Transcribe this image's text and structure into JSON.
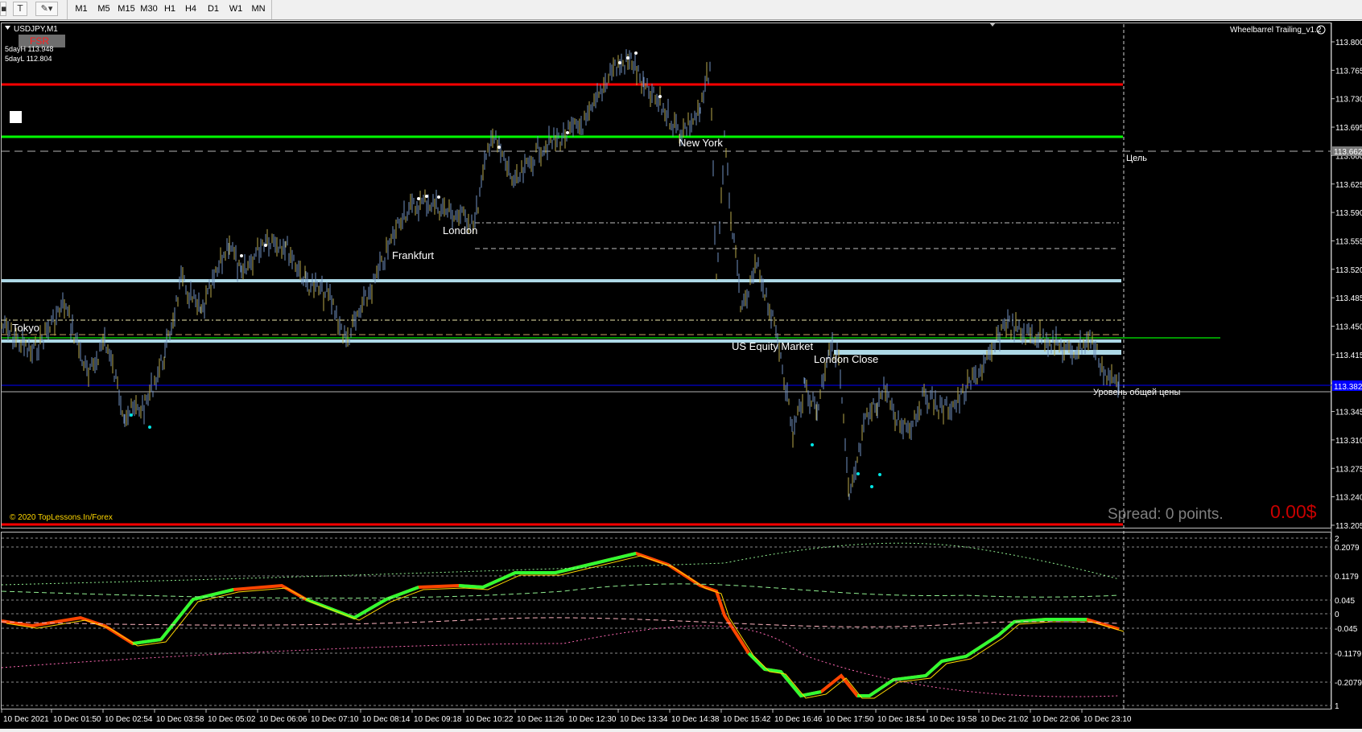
{
  "toolbar": {
    "timeframes": [
      "M1",
      "M5",
      "M15",
      "M30",
      "H1",
      "H4",
      "D1",
      "W1",
      "MN"
    ]
  },
  "chart": {
    "symbol_label": "USDJPY,M1",
    "fsr_label": "FSR",
    "day_high": "5dayH 113.948",
    "day_low": "5dayL 112.804",
    "ea_name": "Wheelbarrel Trailing_v1.2",
    "copyright": "© 2020 TopLessons.In/Forex",
    "spread_text": "Spread: 0 points.",
    "profit_text": "0.00$",
    "target_label": "Цель",
    "common_price_label": "Уровень общей цены",
    "current_price": "113.382",
    "target_price": "113.662",
    "sessions": [
      "Tokyo",
      "Frankfurt",
      "London",
      "New York",
      "US Equity Market",
      "London Close"
    ],
    "price_axis": [
      "113.800",
      "113.765",
      "113.730",
      "113.695",
      "113.660",
      "113.625",
      "113.590",
      "113.555",
      "113.520",
      "113.485",
      "113.450",
      "113.415",
      "113.380",
      "113.345",
      "113.310",
      "113.275",
      "113.240",
      "113.205"
    ],
    "osc_axis": [
      "2",
      "0.2079",
      "0.1179",
      "0.045",
      "0",
      "-0.045",
      "-0.1179",
      "-0.2079",
      "1"
    ],
    "time_axis": [
      "10 Dec 2021",
      "10 Dec 01:50",
      "10 Dec 02:54",
      "10 Dec 03:58",
      "10 Dec 05:02",
      "10 Dec 06:06",
      "10 Dec 07:10",
      "10 Dec 08:14",
      "10 Dec 09:18",
      "10 Dec 10:22",
      "10 Dec 11:26",
      "10 Dec 12:30",
      "10 Dec 13:34",
      "10 Dec 14:38",
      "10 Dec 15:42",
      "10 Dec 16:46",
      "10 Dec 17:50",
      "10 Dec 18:54",
      "10 Dec 19:58",
      "10 Dec 21:02",
      "10 Dec 22:06",
      "10 Dec 23:10"
    ]
  },
  "colors": {
    "background": "#000000",
    "resistance": "#ff0000",
    "support_green": "#00ff00",
    "light_level": "#add8e6",
    "candles": "#6f8fbf",
    "bid_line": "#0000ff",
    "osc_up": "#32ff32",
    "osc_down": "#ff4500",
    "profit": "#c80000"
  }
}
